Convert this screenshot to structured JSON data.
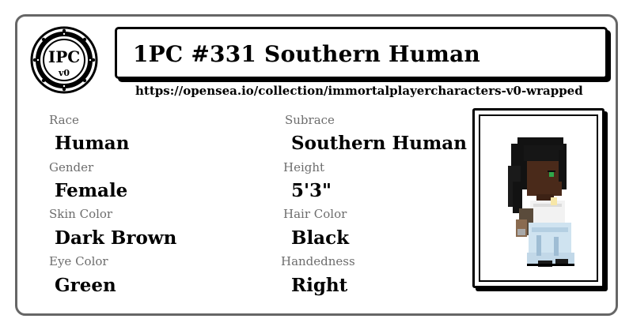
{
  "logo": {
    "icon": "ipc-v0-seal-logo",
    "text_main": "IPC",
    "text_sub": "v0"
  },
  "title": "1PC #331 Southern Human",
  "url": "https://opensea.io/collection/immortalplayercharacters-v0-wrapped",
  "attributes": {
    "race": {
      "label": "Race",
      "value": "Human"
    },
    "subrace": {
      "label": "Subrace",
      "value": "Southern Human"
    },
    "gender": {
      "label": "Gender",
      "value": "Female"
    },
    "height": {
      "label": "Height",
      "value": "5'3\""
    },
    "skin_color": {
      "label": "Skin Color",
      "value": "Dark Brown"
    },
    "hair_color": {
      "label": "Hair Color",
      "value": "Black"
    },
    "eye_color": {
      "label": "Eye Color",
      "value": "Green"
    },
    "handedness": {
      "label": "Handedness",
      "value": "Right"
    }
  },
  "portrait": {
    "icon": "character-sprite-icon"
  },
  "colors": {
    "border": "#666666",
    "label": "#6d6d6d",
    "text": "#000000",
    "skin": "#4a2a1a",
    "hair": "#121212",
    "dress": "#cfe3f0"
  }
}
